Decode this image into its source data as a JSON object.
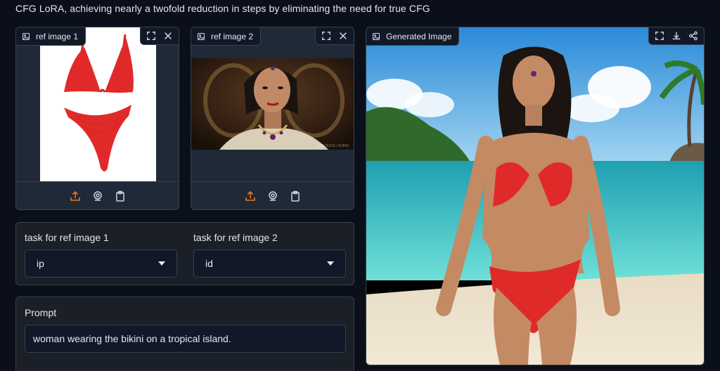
{
  "header": {
    "description": "CFG LoRA, achieving nearly a twofold reduction in steps by eliminating the need for true CFG"
  },
  "ref1": {
    "label": "ref image 1"
  },
  "ref2": {
    "label": "ref image 2",
    "watermark": "PRODUCTIONS"
  },
  "output": {
    "label": "Generated Image"
  },
  "tasks": {
    "task1_label": "task for ref image 1",
    "task1_value": "ip",
    "task2_label": "task for ref image 2",
    "task2_value": "id"
  },
  "prompt": {
    "label": "Prompt",
    "value": "woman wearing the bikini on a tropical island."
  },
  "colors": {
    "accent": "#f97316",
    "bikini": "#e02a2a",
    "bg": "#0b0f19",
    "panel": "#1f2937"
  }
}
